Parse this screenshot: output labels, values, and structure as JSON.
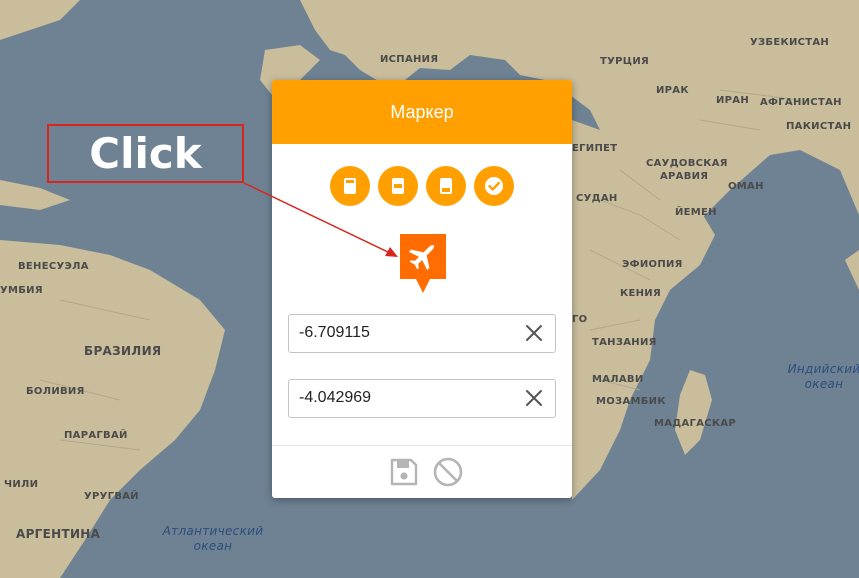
{
  "map": {
    "labels": {
      "spain": "ИСПАНИЯ",
      "turkey": "ТУРЦИЯ",
      "uzbekistan": "УЗБЕКИСТАН",
      "iraq": "ИРАК",
      "iran": "ИРАН",
      "afghanistan": "АФГАНИСТАН",
      "pakistan": "ПАКИСТАН",
      "egypt": "ЕГИПЕТ",
      "saudi_line1": "САУДОВСКАЯ",
      "saudi_line2": "АРАВИЯ",
      "oman": "ОМАН",
      "sudan": "СУДАН",
      "yemen": "ЙЕМЕН",
      "ethiopia": "ЭФИОПИЯ",
      "kenya": "КЕНИЯ",
      "congo_partial": "ГО",
      "tanzania": "ТАНЗАНИЯ",
      "malawi": "МАЛАВИ",
      "mozambique": "МОЗАМБИК",
      "madagascar": "МАДАГАСКАР",
      "venezuela": "ВЕНЕСУЭЛА",
      "colombia_partial": "УМБИЯ",
      "brazil": "БРАЗИЛИЯ",
      "bolivia": "БОЛИВИЯ",
      "paraguay": "ПАРАГВАЙ",
      "chile": "ЧИЛИ",
      "uruguay": "УРУГВАЙ",
      "argentina": "АРГЕНТИНА",
      "atlantic_line1": "Атлантический",
      "atlantic_line2": "океан",
      "indian_line1": "Индийский",
      "indian_line2": "океан"
    }
  },
  "modal": {
    "title": "Маркер",
    "icon_buttons": [
      "marker-style-1-icon",
      "marker-style-2-icon",
      "marker-style-3-icon",
      "confirm-check-icon"
    ],
    "marker_icon": "airplane-icon",
    "latitude": {
      "value": "-6.709115"
    },
    "longitude": {
      "value": "-4.042969"
    },
    "footer": [
      "save-icon",
      "cancel-icon"
    ]
  },
  "annotation": {
    "text": "Click",
    "color": "#d9261c"
  },
  "colors": {
    "accent": "#ffa000",
    "marker": "#ff6d00",
    "water": "#6e8294",
    "land": "#c9bd9c"
  }
}
